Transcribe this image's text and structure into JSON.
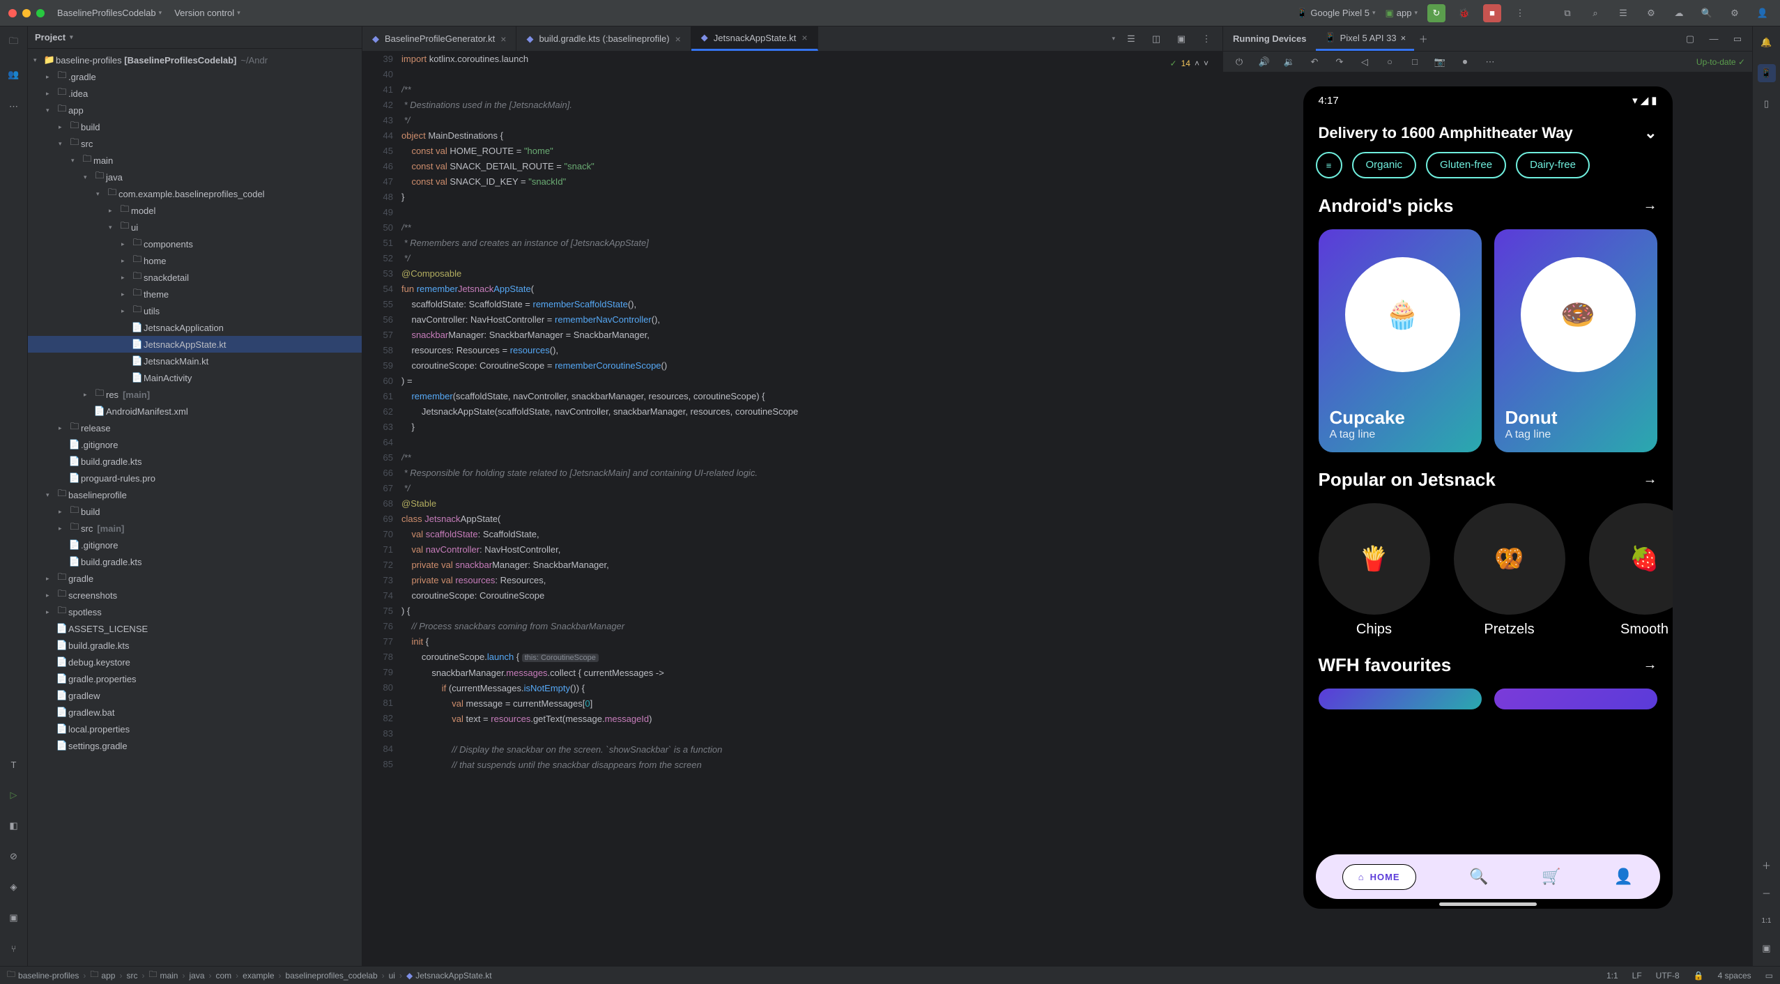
{
  "titlebar": {
    "project": "BaselineProfilesCodelab",
    "vcs": "Version control",
    "device": "Google Pixel 5",
    "run_config": "app"
  },
  "project_panel": {
    "title": "Project",
    "root_name": "baseline-profiles",
    "root_bold": "[BaselineProfilesCodelab]",
    "root_path": "~/Andr",
    "items": {
      "gradle": ".gradle",
      "idea": ".idea",
      "app": "app",
      "build": "build",
      "src": "src",
      "main": "main",
      "java": "java",
      "pkg": "com.example.baselineprofiles_codel",
      "model": "model",
      "ui": "ui",
      "components": "components",
      "home": "home",
      "snackdetail": "snackdetail",
      "theme": "theme",
      "utils": "utils",
      "jetsnack_app": "JetsnackApplication",
      "jetsnack_appstate": "JetsnackAppState.kt",
      "jetsnack_main": "JetsnackMain.kt",
      "main_activity": "MainActivity",
      "res": "res",
      "res_suffix": "[main]",
      "manifest": "AndroidManifest.xml",
      "release": "release",
      "gitignore": ".gitignore",
      "build_gradle": "build.gradle.kts",
      "proguard": "proguard-rules.pro",
      "baselineprofile": "baselineprofile",
      "build2": "build",
      "src2": "src",
      "src2_suffix": "[main]",
      "gitignore2": ".gitignore",
      "build_gradle2": "build.gradle.kts",
      "gradle2": "gradle",
      "screenshots": "screenshots",
      "spotless": "spotless",
      "assets_license": "ASSETS_LICENSE",
      "build_gradle3": "build.gradle.kts",
      "debug_keystore": "debug.keystore",
      "gradle_props": "gradle.properties",
      "gradlew": "gradlew",
      "gradlew_bat": "gradlew.bat",
      "local_props": "local.properties",
      "settings_gradle": "settings.gradle"
    }
  },
  "tabs": [
    {
      "label": "BaselineProfileGenerator.kt",
      "icon": "kt"
    },
    {
      "label": "build.gradle.kts (:baselineprofile)",
      "icon": "gradle"
    },
    {
      "label": "JetsnackAppState.kt",
      "icon": "kt",
      "active": true
    }
  ],
  "inspection": {
    "warnings": "14"
  },
  "code": {
    "lines": [
      {
        "n": 39,
        "segs": [
          [
            "kw",
            "import"
          ],
          [
            "",
            " kotlinx.coroutines.launch"
          ]
        ]
      },
      {
        "n": 40,
        "segs": []
      },
      {
        "n": 41,
        "segs": [
          [
            "cmt",
            "/**"
          ]
        ]
      },
      {
        "n": 42,
        "segs": [
          [
            "cmt",
            " * Destinations used in the ["
          ],
          [
            "cmt",
            "Jetsnack"
          ],
          [
            "cmt",
            "Main]."
          ]
        ]
      },
      {
        "n": 43,
        "segs": [
          [
            "cmt",
            " */"
          ]
        ]
      },
      {
        "n": 44,
        "segs": [
          [
            "kw",
            "object"
          ],
          [
            "",
            " MainDestinations {"
          ]
        ]
      },
      {
        "n": 45,
        "segs": [
          [
            "",
            "    "
          ],
          [
            "kw",
            "const val"
          ],
          [
            "",
            " HOME_ROUTE = "
          ],
          [
            "str",
            "\"home\""
          ]
        ]
      },
      {
        "n": 46,
        "segs": [
          [
            "",
            "    "
          ],
          [
            "kw",
            "const val"
          ],
          [
            "",
            " SNACK_DETAIL_ROUTE = "
          ],
          [
            "str",
            "\"snack\""
          ]
        ]
      },
      {
        "n": 47,
        "segs": [
          [
            "",
            "    "
          ],
          [
            "kw",
            "const val"
          ],
          [
            "",
            " SNACK_ID_KEY = "
          ],
          [
            "str",
            "\"snackId\""
          ]
        ]
      },
      {
        "n": 48,
        "segs": [
          [
            "",
            "}"
          ]
        ]
      },
      {
        "n": 49,
        "segs": []
      },
      {
        "n": 50,
        "segs": [
          [
            "cmt",
            "/**"
          ]
        ]
      },
      {
        "n": 51,
        "segs": [
          [
            "cmt",
            " * Remembers and creates an instance of ["
          ],
          [
            "cmt",
            "Jetsnack"
          ],
          [
            "cmt",
            "AppState]"
          ]
        ]
      },
      {
        "n": 52,
        "segs": [
          [
            "cmt",
            " */"
          ]
        ]
      },
      {
        "n": 53,
        "segs": [
          [
            "ann",
            "@Composable"
          ]
        ]
      },
      {
        "n": 54,
        "segs": [
          [
            "kw",
            "fun"
          ],
          [
            "",
            " "
          ],
          [
            "fn",
            "remember"
          ],
          [
            "ident",
            "Jetsnack"
          ],
          [
            "fn",
            "AppState"
          ],
          [
            "",
            "("
          ]
        ]
      },
      {
        "n": 55,
        "segs": [
          [
            "",
            "    scaffoldState: ScaffoldState = "
          ],
          [
            "fn",
            "rememberScaffoldState"
          ],
          [
            "",
            "(),"
          ]
        ]
      },
      {
        "n": 56,
        "segs": [
          [
            "",
            "    navController: NavHostController = "
          ],
          [
            "fn",
            "rememberNavController"
          ],
          [
            "",
            "(),"
          ]
        ]
      },
      {
        "n": 57,
        "segs": [
          [
            "",
            "    "
          ],
          [
            "ident",
            "snackbar"
          ],
          [
            "",
            "Manager: SnackbarManager = SnackbarManager,"
          ]
        ]
      },
      {
        "n": 58,
        "segs": [
          [
            "",
            "    resources: Resources = "
          ],
          [
            "fn",
            "resources"
          ],
          [
            "",
            "(),"
          ]
        ]
      },
      {
        "n": 59,
        "segs": [
          [
            "",
            "    coroutineScope: CoroutineScope = "
          ],
          [
            "fn",
            "rememberCoroutineScope"
          ],
          [
            "",
            "()"
          ]
        ]
      },
      {
        "n": 60,
        "segs": [
          [
            "",
            ") ="
          ]
        ]
      },
      {
        "n": 61,
        "segs": [
          [
            "",
            "    "
          ],
          [
            "fn",
            "remember"
          ],
          [
            "",
            "(scaffoldState, navController, snackbarManager, resources, coroutineScope) {"
          ]
        ]
      },
      {
        "n": 62,
        "segs": [
          [
            "",
            "        JetsnackAppState(scaffoldState, navController, snackbarManager, resources, coroutineScope"
          ]
        ]
      },
      {
        "n": 63,
        "segs": [
          [
            "",
            "    }"
          ]
        ]
      },
      {
        "n": 64,
        "segs": []
      },
      {
        "n": 65,
        "segs": [
          [
            "cmt",
            "/**"
          ]
        ]
      },
      {
        "n": 66,
        "segs": [
          [
            "cmt",
            " * Responsible for holding state related to ["
          ],
          [
            "cmt",
            "Jetsnack"
          ],
          [
            "cmt",
            "Main"
          ],
          [
            "cmt",
            "] and containing UI-related logic."
          ]
        ]
      },
      {
        "n": 67,
        "segs": [
          [
            "cmt",
            " */"
          ]
        ]
      },
      {
        "n": 68,
        "segs": [
          [
            "ann",
            "@Stable"
          ]
        ]
      },
      {
        "n": 69,
        "segs": [
          [
            "kw",
            "class"
          ],
          [
            "",
            " "
          ],
          [
            "ident",
            "Jetsnack"
          ],
          [
            "",
            "AppState("
          ]
        ]
      },
      {
        "n": 70,
        "segs": [
          [
            "",
            "    "
          ],
          [
            "kw",
            "val"
          ],
          [
            "",
            " "
          ],
          [
            "ident",
            "scaffoldState"
          ],
          [
            "",
            ": ScaffoldState,"
          ]
        ]
      },
      {
        "n": 71,
        "segs": [
          [
            "",
            "    "
          ],
          [
            "kw",
            "val"
          ],
          [
            "",
            " "
          ],
          [
            "ident",
            "navController"
          ],
          [
            "",
            ": NavHostController,"
          ]
        ]
      },
      {
        "n": 72,
        "segs": [
          [
            "",
            "    "
          ],
          [
            "kw",
            "private val"
          ],
          [
            "",
            " "
          ],
          [
            "ident",
            "snackbar"
          ],
          [
            "",
            "Manager: SnackbarManager,"
          ]
        ]
      },
      {
        "n": 73,
        "segs": [
          [
            "",
            "    "
          ],
          [
            "kw",
            "private val"
          ],
          [
            "",
            " "
          ],
          [
            "ident",
            "resources"
          ],
          [
            "",
            ": Resources,"
          ]
        ]
      },
      {
        "n": 74,
        "segs": [
          [
            "",
            "    coroutineScope: CoroutineScope"
          ]
        ]
      },
      {
        "n": 75,
        "segs": [
          [
            "",
            ") {"
          ]
        ]
      },
      {
        "n": 76,
        "segs": [
          [
            "",
            "    "
          ],
          [
            "cmt",
            "// Process "
          ],
          [
            "cmt",
            "snackbars"
          ],
          [
            "cmt",
            " coming from "
          ],
          [
            "cmt",
            "Snackbar"
          ],
          [
            "cmt",
            "Manager"
          ]
        ]
      },
      {
        "n": 77,
        "segs": [
          [
            "",
            "    "
          ],
          [
            "kw",
            "init"
          ],
          [
            "",
            " {"
          ]
        ]
      },
      {
        "n": 78,
        "segs": [
          [
            "",
            "        coroutineScope."
          ],
          [
            "fn",
            "launch"
          ],
          [
            "",
            " { "
          ],
          [
            "hint",
            "this: CoroutineScope"
          ]
        ]
      },
      {
        "n": 79,
        "segs": [
          [
            "",
            "            snackbarManager."
          ],
          [
            "ident",
            "messages"
          ],
          [
            "",
            ".collect { currentMessages ->"
          ]
        ]
      },
      {
        "n": 80,
        "segs": [
          [
            "",
            "                "
          ],
          [
            "kw",
            "if"
          ],
          [
            "",
            " (currentMessages."
          ],
          [
            "fn",
            "isNotEmpty"
          ],
          [
            "",
            "()) {"
          ]
        ]
      },
      {
        "n": 81,
        "segs": [
          [
            "",
            "                    "
          ],
          [
            "kw",
            "val"
          ],
          [
            "",
            " message = currentMessages["
          ],
          [
            "num",
            "0"
          ],
          [
            "",
            "]"
          ]
        ]
      },
      {
        "n": 82,
        "segs": [
          [
            "",
            "                    "
          ],
          [
            "kw",
            "val"
          ],
          [
            "",
            " text = "
          ],
          [
            "ident",
            "resources"
          ],
          [
            "",
            ".getText(message."
          ],
          [
            "ident",
            "messageId"
          ],
          [
            "",
            ")"
          ]
        ]
      },
      {
        "n": 83,
        "segs": []
      },
      {
        "n": 84,
        "segs": [
          [
            "",
            "                    "
          ],
          [
            "cmt",
            "// Display the "
          ],
          [
            "cmt",
            "snackbar"
          ],
          [
            "cmt",
            " on the screen. `show"
          ],
          [
            "cmt",
            "Snackbar"
          ],
          [
            "cmt",
            "` is a function"
          ]
        ]
      },
      {
        "n": 85,
        "segs": [
          [
            "",
            "                    "
          ],
          [
            "cmt",
            "// that suspends until the "
          ],
          [
            "cmt",
            "snackbar"
          ],
          [
            "cmt",
            " disappears from the screen"
          ]
        ]
      }
    ]
  },
  "device_panel": {
    "header": "Running Devices",
    "tab": "Pixel 5 API 33",
    "up_to_date": "Up-to-date"
  },
  "device_screen": {
    "time": "4:17",
    "delivery": "Delivery to 1600 Amphitheater Way",
    "filters": [
      "Organic",
      "Gluten-free",
      "Dairy-free"
    ],
    "section1": "Android's picks",
    "picks": [
      {
        "name": "Cupcake",
        "tag": "A tag line",
        "emoji": "🧁"
      },
      {
        "name": "Donut",
        "tag": "A tag line",
        "emoji": "🍩"
      }
    ],
    "section2": "Popular on Jetsnack",
    "popular": [
      {
        "name": "Chips",
        "emoji": "🍟"
      },
      {
        "name": "Pretzels",
        "emoji": "🥨"
      },
      {
        "name": "Smooth",
        "emoji": "🍓"
      }
    ],
    "section3": "WFH favourites",
    "nav_home": "HOME"
  },
  "breadcrumbs": [
    "baseline-profiles",
    "app",
    "src",
    "main",
    "java",
    "com",
    "example",
    "baselineprofiles_codelab",
    "ui",
    "JetsnackAppState.kt"
  ],
  "statusbar": {
    "pos": "1:1",
    "lf": "LF",
    "encoding": "UTF-8",
    "indent": "4 spaces"
  }
}
